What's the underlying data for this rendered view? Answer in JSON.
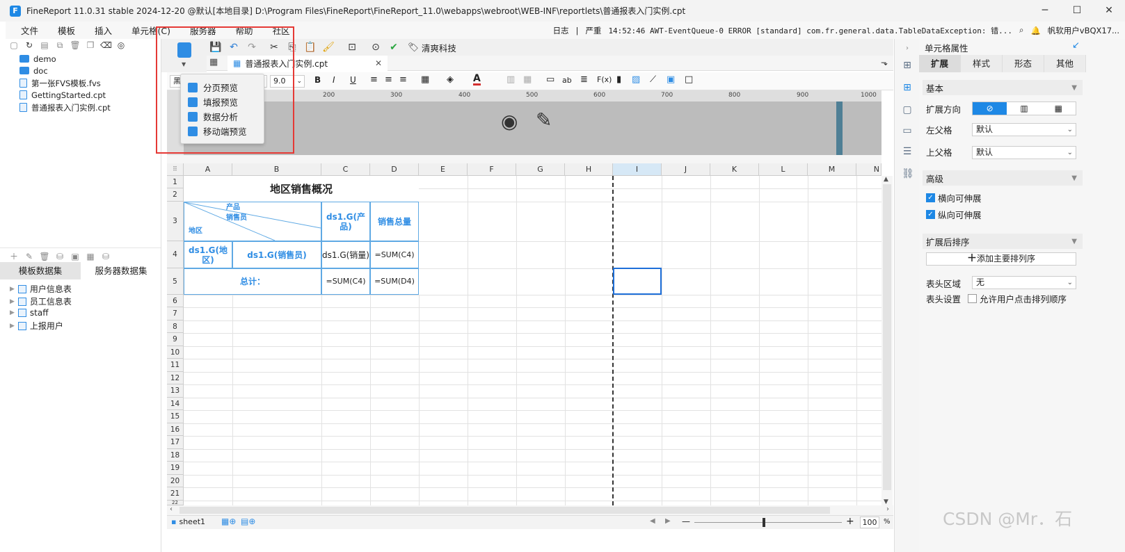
{
  "window": {
    "title": "FineReport 11.0.31 stable 2024-12-20 @默认[本地目录]    D:\\Program Files\\FineReport\\FineReport_11.0\\webapps\\webroot\\WEB-INF\\reportlets\\普通报表入门实例.cpt",
    "minimize": "─",
    "maximize": "☐",
    "close": "✕"
  },
  "menu": {
    "file": "文件",
    "template": "模板",
    "insert": "插入",
    "cell": "单元格(C)",
    "server": "服务器",
    "help": "帮助",
    "community": "社区"
  },
  "status": {
    "log": "日志",
    "separator": "|",
    "level": "严重",
    "logline": "14:52:46 AWT-EventQueue-0 ERROR [standard] com.fr.general.data.TableDataException: 错...",
    "user": "帆软用户vBQX17..."
  },
  "left_tree": [
    {
      "label": "demo",
      "type": "folder"
    },
    {
      "label": "doc",
      "type": "folder"
    },
    {
      "label": "第一张FVS模板.fvs",
      "type": "file"
    },
    {
      "label": "GettingStarted.cpt",
      "type": "file"
    },
    {
      "label": "普通报表入门实例.cpt",
      "type": "file"
    }
  ],
  "dataset_tabs": {
    "template": "模板数据集",
    "server": "服务器数据集"
  },
  "datasets": [
    "用户信息表",
    "员工信息表",
    "staff",
    "上报用户"
  ],
  "toolbar": {
    "brand": "清爽科技"
  },
  "file_tab": {
    "label": "普通报表入门实例.cpt",
    "close": "✕"
  },
  "format": {
    "font": "黑",
    "size": "9.0",
    "bold": "B",
    "italic": "I",
    "underline": "U",
    "ab": "ab",
    "fx": "F(x)"
  },
  "preview_menu": [
    "分页预览",
    "填报预览",
    "数据分析",
    "移动端预览"
  ],
  "ruler_ticks": [
    "200",
    "300",
    "400",
    "500",
    "600",
    "700",
    "800",
    "900",
    "1000"
  ],
  "columns": [
    "A",
    "B",
    "C",
    "D",
    "E",
    "F",
    "G",
    "H",
    "I",
    "J",
    "K",
    "L",
    "M",
    "N"
  ],
  "rows": [
    "1",
    "2",
    "3",
    "4",
    "5",
    "6",
    "7",
    "8",
    "9",
    "10",
    "11",
    "12",
    "13",
    "14",
    "15",
    "16",
    "17",
    "18",
    "19",
    "20",
    "21",
    "22"
  ],
  "report": {
    "title": "地区销售概况",
    "header_product": "产品",
    "header_sales": "销售员",
    "header_region": "地区",
    "c3": "ds1.G(产品)",
    "d3": "销售总量",
    "a4": "ds1.G(地区)",
    "b4": "ds1.G(销售员)",
    "c4": "ds1.G(销量)",
    "d4": "=SUM(C4)",
    "a5": "总计：",
    "c5": "=SUM(C4)",
    "d5": "=SUM(D4)"
  },
  "sheet": {
    "name": "sheet1",
    "zoom": "100",
    "pct": "%",
    "minus": "—",
    "plus": "+"
  },
  "right_panel": {
    "title": "单元格属性",
    "tabs": [
      "扩展",
      "样式",
      "形态",
      "其他"
    ],
    "basic": "基本",
    "expand_dir": "扩展方向",
    "left_parent": "左父格",
    "left_parent_val": "默认",
    "top_parent": "上父格",
    "top_parent_val": "默认",
    "advanced": "高级",
    "h_expand": "横向可伸展",
    "v_expand": "纵向可伸展",
    "sort": "扩展后排序",
    "add_sort": "添加主要排列序",
    "header_area": "表头区域",
    "header_area_val": "无",
    "header_settings": "表头设置",
    "allow_sort": "允许用户点击排列顺序"
  },
  "watermark": "CSDN @Mr．石",
  "colors": {
    "accent": "#2f8de4",
    "highlight": "#e53935"
  }
}
